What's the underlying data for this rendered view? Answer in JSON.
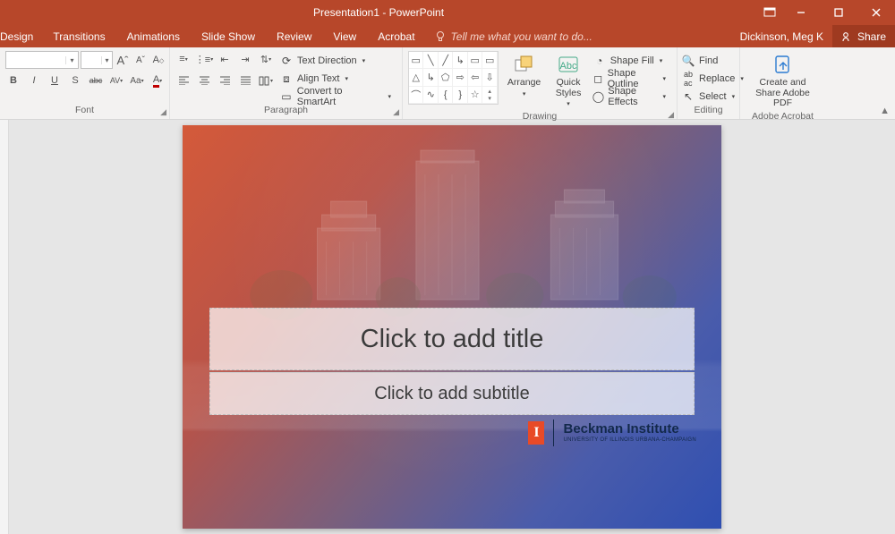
{
  "titlebar": {
    "title": "Presentation1 - PowerPoint"
  },
  "tabs": {
    "design": "Design",
    "transitions": "Transitions",
    "animations": "Animations",
    "slideshow": "Slide Show",
    "review": "Review",
    "view": "View",
    "acrobat": "Acrobat",
    "tellme": "Tell me what you want to do..."
  },
  "user": {
    "name": "Dickinson, Meg K",
    "share": "Share"
  },
  "font": {
    "label": "Font",
    "bold": "B",
    "italic": "I",
    "underline": "U",
    "strike": "S",
    "shadow": "abc",
    "spacing": "AV",
    "case": "Aa",
    "color": "A",
    "grow": "A",
    "shrink": "A",
    "clear": "A"
  },
  "paragraph": {
    "label": "Paragraph",
    "textdir": "Text Direction",
    "aligntext": "Align Text",
    "smartart": "Convert to SmartArt"
  },
  "drawing": {
    "label": "Drawing",
    "arrange": "Arrange",
    "quickstyles": "Quick Styles",
    "shapefill": "Shape Fill",
    "shapeoutline": "Shape Outline",
    "shapeeffects": "Shape Effects"
  },
  "editing": {
    "label": "Editing",
    "find": "Find",
    "replace": "Replace",
    "select": "Select"
  },
  "acrobat_grp": {
    "label": "Adobe Acrobat",
    "button": "Create and Share Adobe PDF"
  },
  "slide": {
    "title_placeholder": "Click to add title",
    "subtitle_placeholder": "Click to add subtitle",
    "logo_main": "Beckman Institute",
    "logo_sub": "UNIVERSITY OF ILLINOIS URBANA-CHAMPAIGN",
    "logo_letter": "I"
  }
}
